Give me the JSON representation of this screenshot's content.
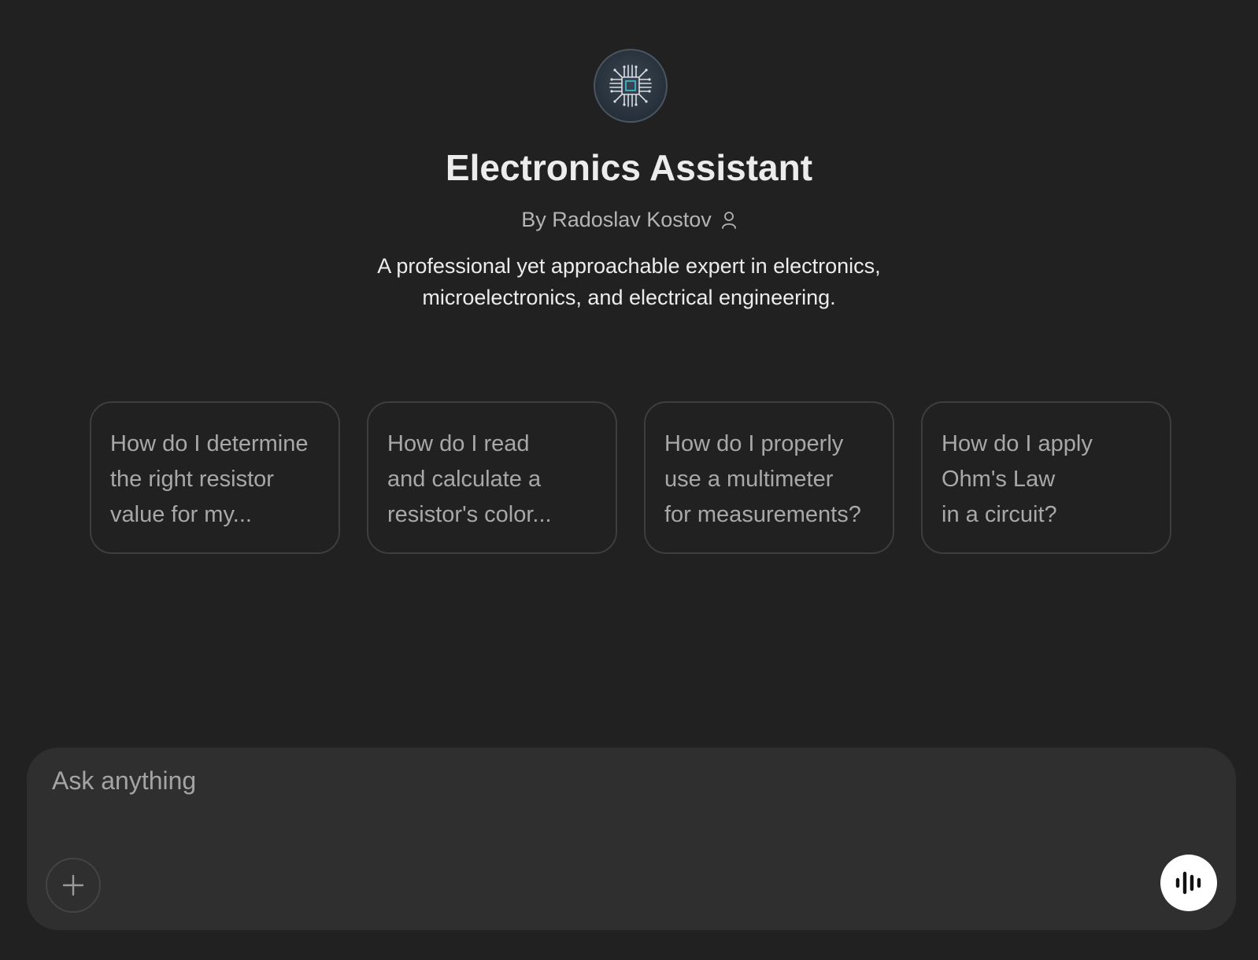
{
  "gpt": {
    "title": "Electronics Assistant",
    "byline": "By Radoslav Kostov",
    "description": "A professional yet approachable expert in electronics, microelectronics, and electrical engineering.",
    "avatar_icon": "microchip-icon",
    "author_icon": "person-icon"
  },
  "starters": [
    {
      "label": "How do I determine\nthe right resistor\nvalue for my..."
    },
    {
      "label": "How do I read\nand calculate a\nresistor's color..."
    },
    {
      "label": "How do I properly\nuse a multimeter\nfor measurements?"
    },
    {
      "label": "How do I apply\nOhm's Law\nin a circuit?"
    }
  ],
  "composer": {
    "placeholder": "Ask anything",
    "attach_icon": "plus-icon",
    "voice_icon": "voice-waveform-icon"
  },
  "colors": {
    "background": "#212121",
    "composer_bg": "#2f2f2f",
    "card_border": "#3e3e3e",
    "avatar_accent": "#3fc1d9"
  }
}
